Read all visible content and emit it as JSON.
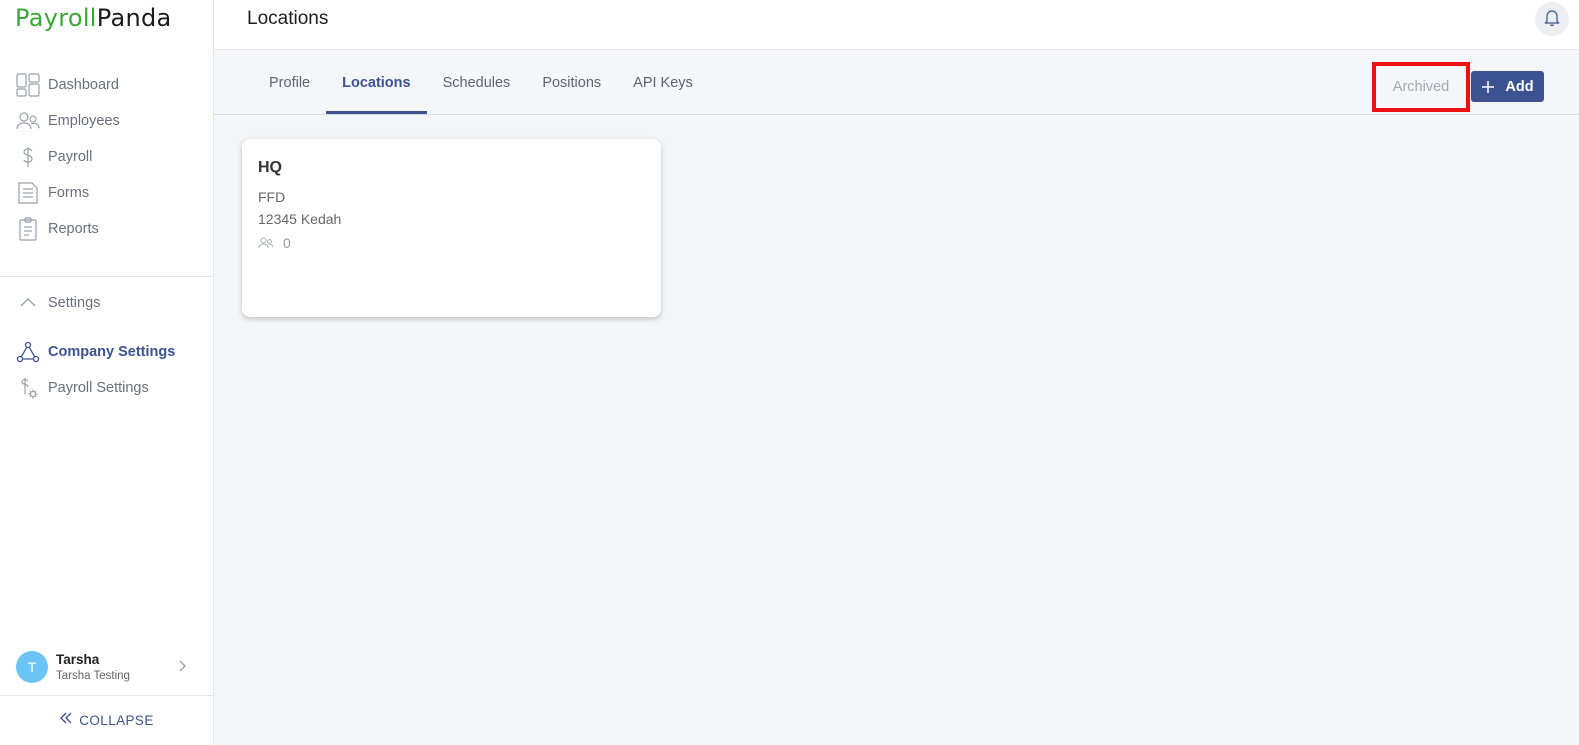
{
  "app": {
    "logo_part1": "Payroll",
    "logo_part2": "Panda"
  },
  "sidebar": {
    "items": [
      {
        "label": "Dashboard",
        "icon": "dashboard-icon"
      },
      {
        "label": "Employees",
        "icon": "employees-icon"
      },
      {
        "label": "Payroll",
        "icon": "dollar-icon"
      },
      {
        "label": "Forms",
        "icon": "forms-icon"
      },
      {
        "label": "Reports",
        "icon": "clipboard-icon"
      }
    ],
    "settings": {
      "label": "Settings",
      "icon": "chevron-up-icon"
    },
    "settings_items": [
      {
        "label": "Company Settings",
        "icon": "company-network-icon",
        "active": true
      },
      {
        "label": "Payroll Settings",
        "icon": "payroll-settings-icon",
        "active": false
      }
    ],
    "user": {
      "initial": "T",
      "name": "Tarsha",
      "company": "Tarsha Testing"
    },
    "collapse_label": "COLLAPSE"
  },
  "header": {
    "title": "Locations",
    "bell_icon": "bell-icon"
  },
  "tabs": [
    {
      "label": "Profile",
      "active": false
    },
    {
      "label": "Locations",
      "active": true
    },
    {
      "label": "Schedules",
      "active": false
    },
    {
      "label": "Positions",
      "active": false
    },
    {
      "label": "API Keys",
      "active": false
    }
  ],
  "actions": {
    "archived_label": "Archived",
    "add_label": "Add"
  },
  "locations": [
    {
      "name": "HQ",
      "line1": "FFD",
      "line2": "12345 Kedah",
      "employee_count": "0"
    }
  ],
  "colors": {
    "brand_green": "#3aa635",
    "primary": "#3d5290",
    "highlight_border": "#ee1111",
    "avatar": "#6cc3f5"
  }
}
